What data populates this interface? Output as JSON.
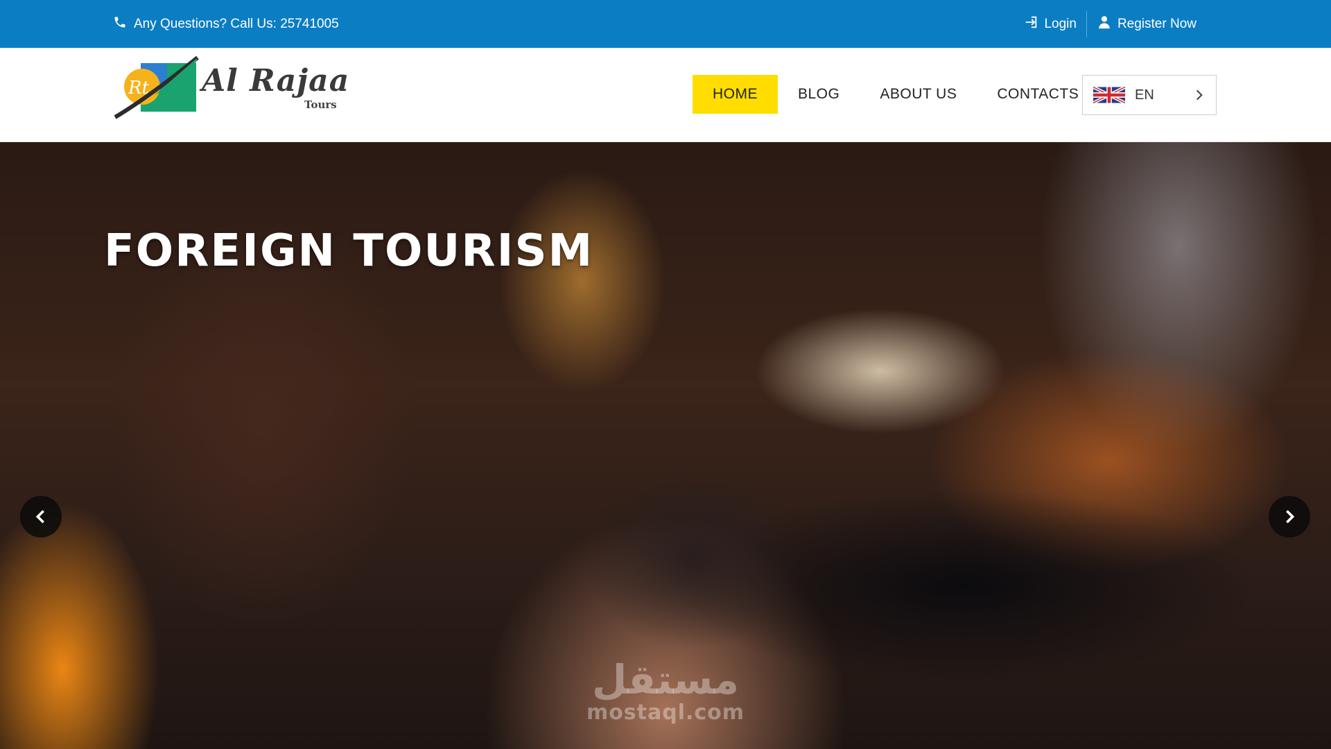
{
  "topbar": {
    "phone_text": "Any Questions? Call Us: 25741005",
    "login_label": "Login",
    "register_label": "Register Now",
    "background_color": "#0b7dc3"
  },
  "header": {
    "logo": {
      "brand_name": "Al Rajaa",
      "brand_sub": "Tours",
      "mark_text": "Rt"
    },
    "nav": [
      {
        "label": "HOME",
        "active": true
      },
      {
        "label": "BLOG",
        "active": false
      },
      {
        "label": "ABOUT US",
        "active": false
      },
      {
        "label": "CONTACTS",
        "active": false
      }
    ],
    "active_color": "#ffdd00",
    "language": {
      "code": "EN",
      "flag_icon": "uk-flag-icon"
    }
  },
  "hero": {
    "title": "FOREIGN TOURISM",
    "prev_icon": "chevron-left-icon",
    "next_icon": "chevron-right-icon",
    "watermark_arabic": "مستقل",
    "watermark_latin": "mostaql.com"
  }
}
